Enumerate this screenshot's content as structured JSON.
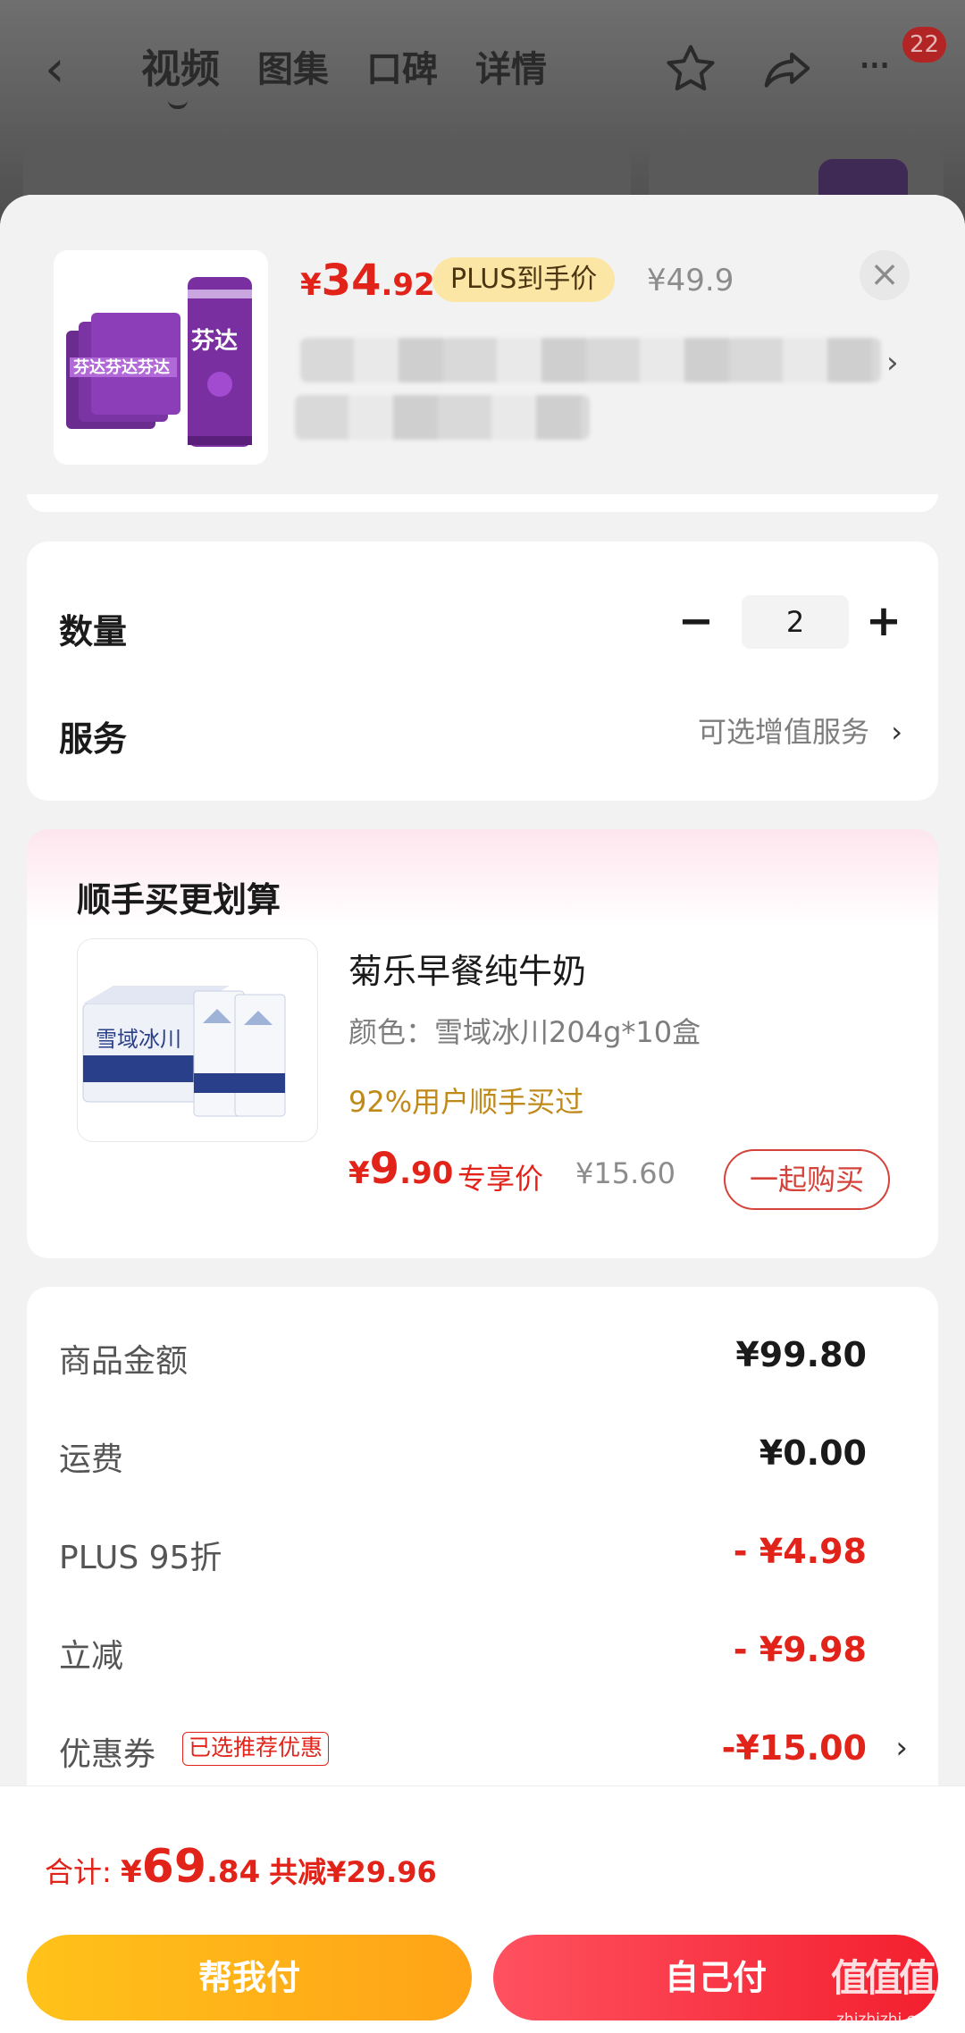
{
  "background_nav": {
    "tabs": [
      "视频",
      "图集",
      "口碑",
      "详情"
    ],
    "active_tab": "视频",
    "badge_count": "22"
  },
  "product": {
    "price_symbol": "¥",
    "price_int": "34",
    "price_dec": ".92",
    "plus_label": "PLUS到手价",
    "original_price": "¥49.9",
    "close_icon": "close-icon"
  },
  "options": {
    "quantity_label": "数量",
    "quantity_value": "2",
    "service_label": "服务",
    "service_value": "可选增值服务"
  },
  "bundle": {
    "title": "顺手买更划算",
    "item_name": "菊乐早餐纯牛奶",
    "item_spec": "颜色：雪域冰川204g*10盒",
    "item_stat": "92%用户顺手买过",
    "price_symbol": "¥",
    "price_int": "9",
    "price_dec": ".90",
    "exclusive_label": "专享价",
    "original_price": "¥15.60",
    "buy_button": "一起购买",
    "thumb_text": "雪域冰川"
  },
  "summary": {
    "rows": [
      {
        "label": "商品金额",
        "value": "¥99.80"
      },
      {
        "label": "运费",
        "value": "¥0.00"
      },
      {
        "label": "PLUS 95折",
        "value": "- ¥4.98"
      },
      {
        "label": "立减",
        "value": "- ¥9.98"
      },
      {
        "label": "优惠券",
        "value": "-¥15.00",
        "tag": "已选推荐优惠"
      }
    ]
  },
  "footer": {
    "total_label": "合计: ",
    "total_symbol": "¥",
    "total_int": "69",
    "total_dec": ".84",
    "saved": "共减¥29.96",
    "help_pay": "帮我付",
    "self_pay": "自己付"
  },
  "watermark": {
    "logo": "值值值",
    "url": "zhizhizhi.com"
  },
  "colors": {
    "accent_red": "#e2231a",
    "plus_gold": "#fbe6a6",
    "help_pay_yellow": "#ffb31a",
    "self_pay_red": "#f3323f"
  }
}
